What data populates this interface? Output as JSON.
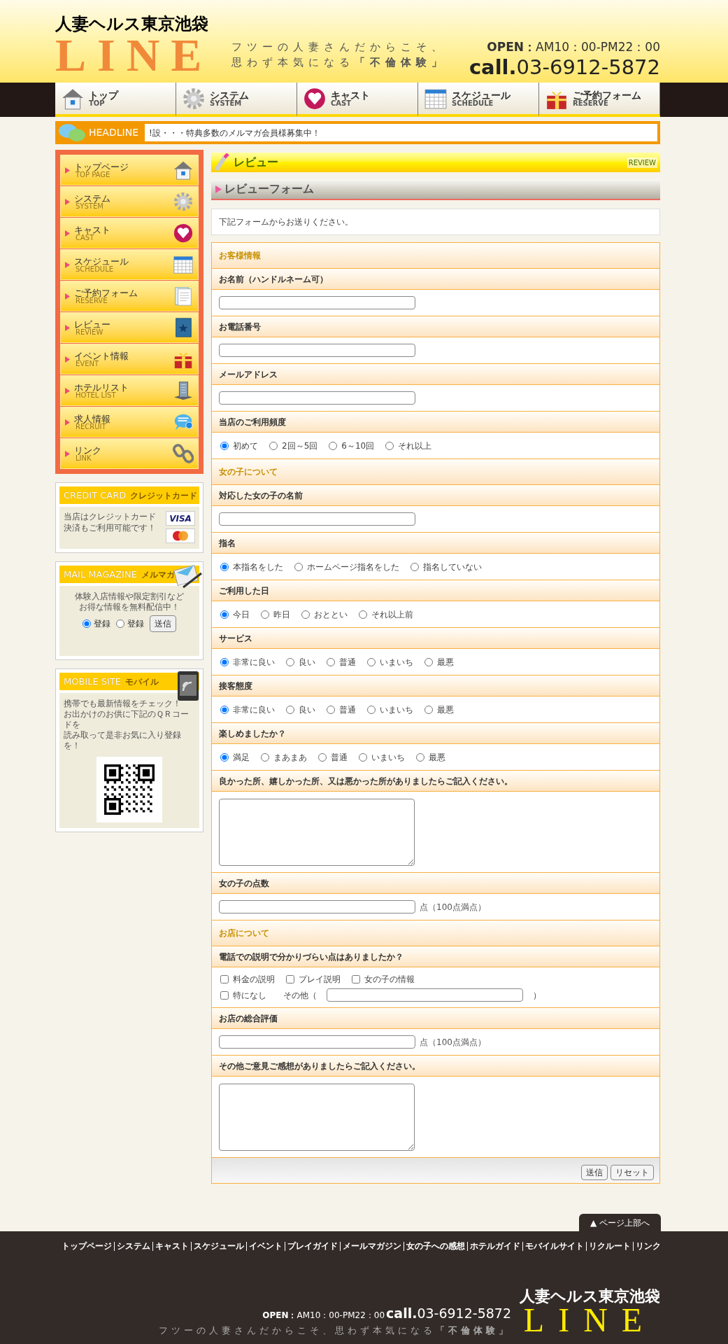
{
  "header": {
    "logo_top": "人**妻**ヘルス東京池袋",
    "logo_main": "LINE",
    "tagline_1": "フツーの人妻さんだからこそ、",
    "tagline_2": "思わず本気になる**「不倫体験」**",
    "hours": "**OPEN：**AM10：00-PM22：00",
    "phone": "**call.**03-6912-5872"
  },
  "nav": [
    {
      "label": "トップ",
      "sub": "TOP"
    },
    {
      "label": "システム",
      "sub": "SYSTEM"
    },
    {
      "label": "キャスト",
      "sub": "CAST"
    },
    {
      "label": "スケジュール",
      "sub": "SCHEDULE"
    },
    {
      "label": "ご予約フォーム",
      "sub": "RESERVE"
    }
  ],
  "headline": {
    "label": "HEADLINE",
    "text": "!設・・・特典多数のメルマガ会員様募集中！"
  },
  "sidebar_menu": [
    {
      "label": "トップページ",
      "sub": "TOP PAGE"
    },
    {
      "label": "システム",
      "sub": "SYSTEM"
    },
    {
      "label": "キャスト",
      "sub": "CAST"
    },
    {
      "label": "スケジュール",
      "sub": "SCHEDULE"
    },
    {
      "label": "ご予約フォーム",
      "sub": "RESERVE"
    },
    {
      "label": "レビュー",
      "sub": "REVIEW"
    },
    {
      "label": "イベント情報",
      "sub": "EVENT"
    },
    {
      "label": "ホテルリスト",
      "sub": "HOTEL LIST"
    },
    {
      "label": "求人情報",
      "sub": "RECRUIT"
    },
    {
      "label": "リンク",
      "sub": "LINK"
    }
  ],
  "credit_card": {
    "title": "CREDIT CARD",
    "sub": "クレジットカード",
    "text": "当店はクレジットカード決済もご利用可能です！",
    "card": "VISA"
  },
  "mail_magazine": {
    "title": "MAIL MAGAZINE",
    "sub": "メルマガ",
    "lines": [
      "体験入店情報や限定割引など",
      "お得な情報を無料配信中！"
    ],
    "options": [
      {
        "label": "登録",
        "selected": true
      },
      {
        "label": "登録",
        "selected": false
      }
    ],
    "button": "送信"
  },
  "mobile_site": {
    "title": "MOBILE SITE",
    "sub": "モバイル",
    "lines": [
      "携帯でも最新情報をチェック！",
      "お出かけのお供に下記のＱＲコードを",
      "読み取って是非お気に入り登録を！"
    ]
  },
  "page_title": {
    "label": "レビュー",
    "sub": "REVIEW"
  },
  "form_title": "レビューフォーム",
  "intro": "下記フォームからお送りください。",
  "form_rows": [
    {
      "kind": "section",
      "label": "お客様情報"
    },
    {
      "kind": "label",
      "label": "お名前（ハンドルネーム可）"
    },
    {
      "kind": "text"
    },
    {
      "kind": "label",
      "label": "お電話番号"
    },
    {
      "kind": "text"
    },
    {
      "kind": "label",
      "label": "メールアドレス"
    },
    {
      "kind": "text"
    },
    {
      "kind": "label",
      "label": "当店のご利用頻度"
    },
    {
      "kind": "radio",
      "options": [
        {
          "label": "初めて",
          "selected": true
        },
        {
          "label": "2回～5回",
          "selected": false
        },
        {
          "label": "6～10回",
          "selected": false
        },
        {
          "label": "それ以上",
          "selected": false
        }
      ]
    },
    {
      "kind": "section",
      "label": "女の子について"
    },
    {
      "kind": "label",
      "label": "対応した女の子の名前"
    },
    {
      "kind": "text"
    },
    {
      "kind": "label",
      "label": "指名"
    },
    {
      "kind": "radio",
      "options": [
        {
          "label": "本指名をした",
          "selected": true
        },
        {
          "label": "ホームページ指名をした",
          "selected": false
        },
        {
          "label": "指名していない",
          "selected": false
        }
      ]
    },
    {
      "kind": "label",
      "label": "ご利用した日"
    },
    {
      "kind": "radio",
      "options": [
        {
          "label": "今日",
          "selected": true
        },
        {
          "label": "昨日",
          "selected": false
        },
        {
          "label": "おととい",
          "selected": false
        },
        {
          "label": "それ以上前",
          "selected": false
        }
      ]
    },
    {
      "kind": "label",
      "label": "サービス"
    },
    {
      "kind": "radio",
      "options": [
        {
          "label": "非常に良い",
          "selected": true
        },
        {
          "label": "良い",
          "selected": false
        },
        {
          "label": "普通",
          "selected": false
        },
        {
          "label": "いまいち",
          "selected": false
        },
        {
          "label": "最悪",
          "selected": false
        }
      ]
    },
    {
      "kind": "label",
      "label": "接客態度"
    },
    {
      "kind": "radio",
      "options": [
        {
          "label": "非常に良い",
          "selected": true
        },
        {
          "label": "良い",
          "selected": false
        },
        {
          "label": "普通",
          "selected": false
        },
        {
          "label": "いまいち",
          "selected": false
        },
        {
          "label": "最悪",
          "selected": false
        }
      ]
    },
    {
      "kind": "label",
      "label": "楽しめましたか？"
    },
    {
      "kind": "radio",
      "options": [
        {
          "label": "満足",
          "selected": true
        },
        {
          "label": "まあまあ",
          "selected": false
        },
        {
          "label": "普通",
          "selected": false
        },
        {
          "label": "いまいち",
          "selected": false
        },
        {
          "label": "最悪",
          "selected": false
        }
      ]
    },
    {
      "kind": "label",
      "label": "良かった所、嬉しかった所、又は悪かった所がありましたらご記入ください。"
    },
    {
      "kind": "textarea"
    },
    {
      "kind": "label",
      "label": "女の子の点数"
    },
    {
      "kind": "text",
      "suffix": "点（100点満点）"
    },
    {
      "kind": "section",
      "label": "お店について"
    },
    {
      "kind": "label",
      "label": "電話での説明で分かりづらい点はありましたか？"
    },
    {
      "kind": "checks",
      "lines": [
        [
          {
            "label": "料金の説明",
            "checked": false
          },
          {
            "label": "プレイ説明",
            "checked": false
          },
          {
            "label": "女の子の情報",
            "checked": false
          }
        ],
        [
          {
            "label": "特になし",
            "checked": false
          }
        ]
      ],
      "other_label": "その他（",
      "other_close": "）"
    },
    {
      "kind": "label",
      "label": "お店の総合評価"
    },
    {
      "kind": "text",
      "suffix": "点（100点満点）"
    },
    {
      "kind": "label",
      "label": "その他ご意見ご感想がありましたらご記入ください。"
    },
    {
      "kind": "textarea"
    }
  ],
  "form_buttons": [
    "送信",
    "リセット"
  ],
  "to_top": "▲ ページ上部へ",
  "footer_links": [
    "トップページ",
    "システム",
    "キャスト",
    "スケジュール",
    "イベント",
    "プレイガイド",
    "メールマガジン",
    "女の子への感想",
    "ホテルガイド",
    "モバイルサイト",
    "リクルート",
    "リンク"
  ],
  "footer": {
    "hours": "**OPEN：**AM10：00-PM22：00",
    "phone": "**call.**03-6912-5872",
    "tagline": "フツーの人妻さんだからこそ、思わず本気になる**「不倫体験」**",
    "logo_top": "人**妻**ヘルス東京池袋",
    "logo_main": "LINE"
  }
}
